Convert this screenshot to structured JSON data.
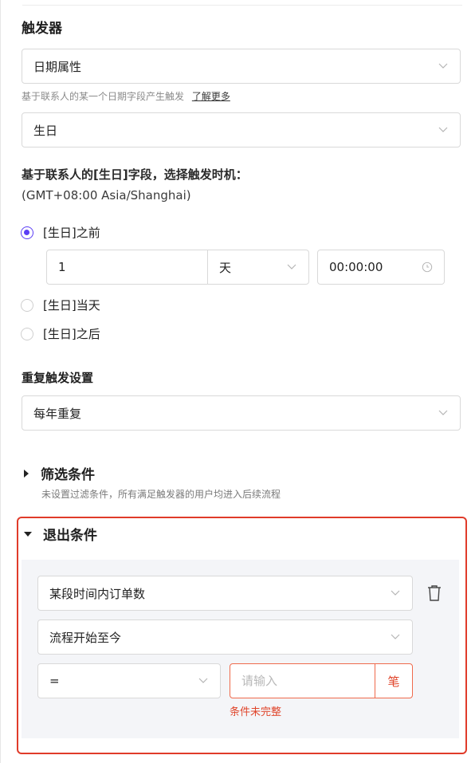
{
  "trigger": {
    "title": "触发器",
    "type_select": "日期属性",
    "hint": "基于联系人的某一个日期字段产生触发",
    "learn_more": "了解更多",
    "field_select": "生日",
    "timing_label": "基于联系人的[生日]字段，选择触发时机：",
    "timezone": "(GMT+08:00 Asia/Shanghai)",
    "options": [
      {
        "label": "[生日]之前",
        "selected": true
      },
      {
        "label": "[生日]当天",
        "selected": false
      },
      {
        "label": "[生日]之后",
        "selected": false
      }
    ],
    "offset_value": "1",
    "offset_unit": "天",
    "time_value": "00:00:00"
  },
  "repeat": {
    "title": "重复触发设置",
    "select": "每年重复"
  },
  "filter": {
    "title": "筛选条件",
    "hint": "未设置过滤条件，所有满足触发器的用户均进入后续流程"
  },
  "exit": {
    "title": "退出条件",
    "condition_select": "某段时间内订单数",
    "range_select": "流程开始至今",
    "operator_select": "=",
    "value_placeholder": "请输入",
    "unit": "笔",
    "error": "条件未完整"
  },
  "colors": {
    "accent": "#5b3ef5",
    "error": "#e03b2a",
    "panel_bg": "#f4f5f8"
  }
}
